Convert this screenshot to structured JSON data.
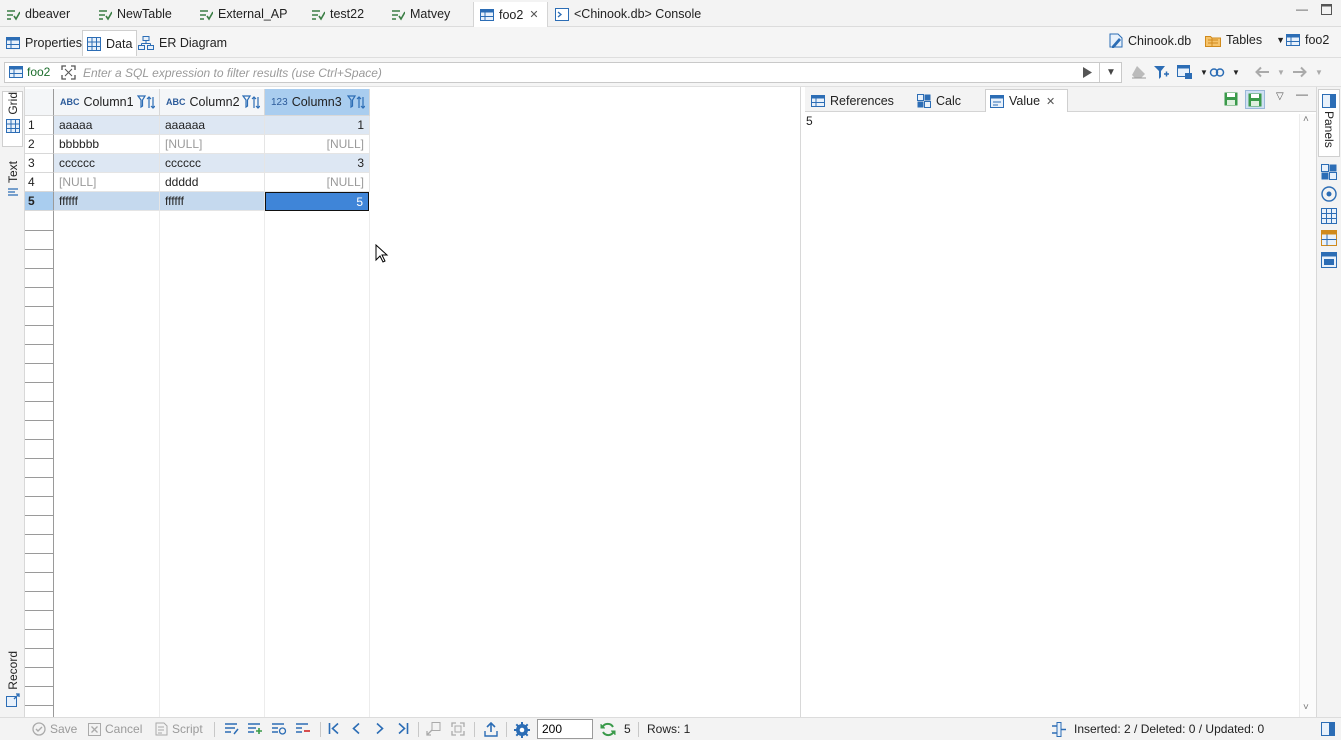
{
  "editor_tabs": [
    {
      "label": "dbeaver",
      "icon": "sql-script-icon"
    },
    {
      "label": "NewTable",
      "icon": "sql-script-icon"
    },
    {
      "label": "External_AP",
      "icon": "sql-script-icon"
    },
    {
      "label": "test22",
      "icon": "sql-script-icon"
    },
    {
      "label": "Matvey",
      "icon": "sql-script-icon"
    },
    {
      "label": "foo2",
      "icon": "table-icon",
      "active": true
    },
    {
      "label": "<Chinook.db> Console",
      "icon": "console-icon"
    }
  ],
  "sub_tabs": {
    "properties": "Properties",
    "data": "Data",
    "er_diagram": "ER Diagram"
  },
  "context": {
    "database": "Chinook.db",
    "folder": "Tables",
    "table": "foo2"
  },
  "filter": {
    "table_label": "foo2",
    "placeholder": "Enter a SQL expression to filter results (use Ctrl+Space)"
  },
  "left_tabs": {
    "grid": "Grid",
    "text": "Text",
    "record": "Record"
  },
  "grid": {
    "columns": [
      {
        "type": "ABC",
        "name": "Column1"
      },
      {
        "type": "ABC",
        "name": "Column2"
      },
      {
        "type": "123",
        "name": "Column3"
      }
    ],
    "rows": [
      {
        "num": "1",
        "c1": "aaaaa",
        "c2": "aaaaaa",
        "c3": "1"
      },
      {
        "num": "2",
        "c1": "bbbbbb",
        "c2": "[NULL]",
        "c3": "[NULL]"
      },
      {
        "num": "3",
        "c1": "cccccc",
        "c2": "cccccc",
        "c3": "3"
      },
      {
        "num": "4",
        "c1": "[NULL]",
        "c2": "ddddd",
        "c3": "[NULL]"
      },
      {
        "num": "5",
        "c1": "ffffff",
        "c2": "ffffff",
        "c3": "5"
      }
    ]
  },
  "panel": {
    "tabs": {
      "references": "References",
      "calc": "Calc",
      "value": "Value"
    },
    "value_text": "5"
  },
  "right_bar": {
    "panels": "Panels"
  },
  "status": {
    "save": "Save",
    "cancel": "Cancel",
    "script": "Script",
    "fetch_size": "200",
    "refresh_count": "5",
    "rows": "Rows: 1",
    "summary": "Inserted: 2 / Deleted: 0 / Updated: 0"
  },
  "colors": {
    "selection": "#a9cdef",
    "focus_cell": "#3f85d8",
    "row_highlight": "#dde7f3",
    "script_icon": "#2e8b57",
    "accent_blue": "#2c6db5"
  }
}
